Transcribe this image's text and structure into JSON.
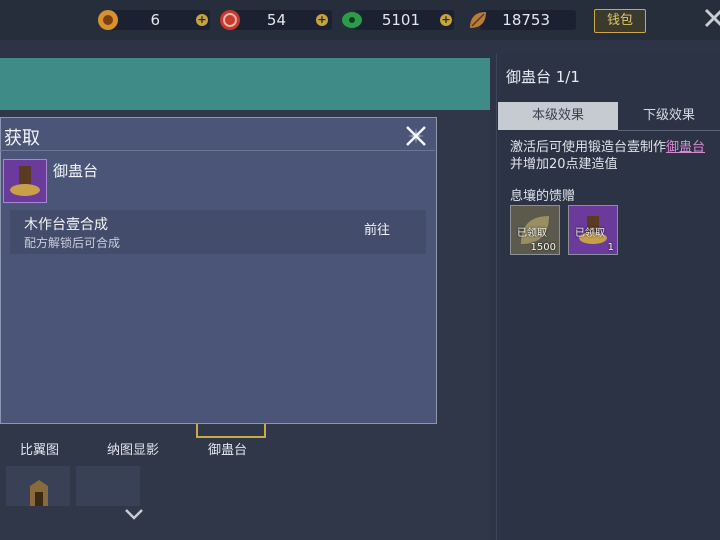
{
  "resources": [
    {
      "icon": "gourd-coin-icon",
      "value": "6",
      "color": "#d9912f"
    },
    {
      "icon": "red-spiral-icon",
      "value": "54",
      "color": "#c43a2e"
    },
    {
      "icon": "green-jade-icon",
      "value": "5101",
      "color": "#2e9b4a"
    },
    {
      "icon": "bronze-leaf-icon",
      "value": "18753",
      "color": "#b97d3a"
    }
  ],
  "wallet_label": "钱包",
  "dialog": {
    "title": "获取",
    "item_name": "御蛊台",
    "source": {
      "title": "木作台壹合成",
      "subtitle": "配方解锁后可合成",
      "go_label": "前往"
    }
  },
  "right": {
    "title": "御蛊台 1/1",
    "tabs": [
      "本级效果",
      "下级效果"
    ],
    "desc_line1_prefix": "激活后可使用锻造台壹制作",
    "desc_line1_link": "御蛊台",
    "desc_line2": "并增加20点建造值",
    "gift_title": "息壤的馈赠",
    "gifts": [
      {
        "tag": "已领取",
        "count": "1500"
      },
      {
        "tag": "已领取",
        "count": "1"
      }
    ]
  },
  "bottom_labels": [
    "比翼图",
    "纳图显影",
    "御蛊台"
  ],
  "colors": {
    "accent_gold": "#c9a94a",
    "link_purple": "#d58ad2"
  }
}
